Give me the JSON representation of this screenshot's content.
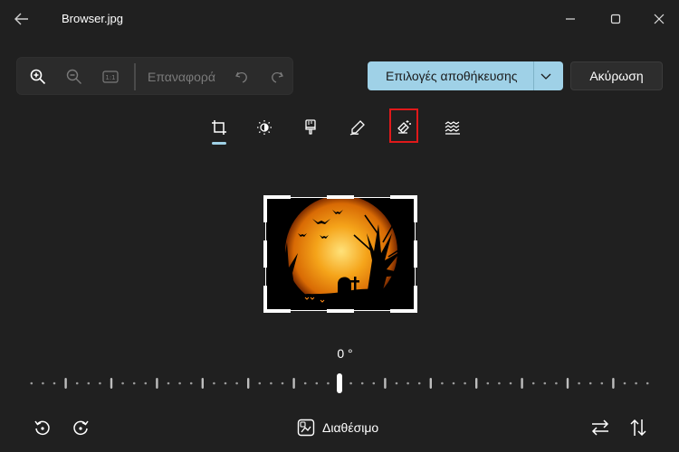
{
  "titlebar": {
    "title": "Browser.jpg",
    "icons": {
      "back": "back-arrow-icon",
      "minimize": "minimize-icon",
      "maximize": "maximize-icon",
      "close": "close-icon"
    }
  },
  "toolbar": {
    "reset_label": "Επαναφορά",
    "actual_size_label": "1:1",
    "icons": [
      "zoom-in-icon",
      "zoom-out-icon",
      "actual-size-icon",
      "undo-icon",
      "redo-icon"
    ]
  },
  "actions": {
    "save_options_label": "Επιλογές αποθήκευσης",
    "cancel_label": "Ακύρωση",
    "accent_color": "#9fd1e7"
  },
  "tools": {
    "items": [
      "crop-tool",
      "adjustment-tool",
      "filter-tool",
      "markup-tool",
      "retouch-tool",
      "background-blur-tool"
    ],
    "selected": "crop-tool",
    "highlighted": "retouch-tool",
    "highlight_color": "#e0191a"
  },
  "rotation": {
    "angle_label": "0 °",
    "angle_value": 0
  },
  "bottom": {
    "aspect_label": "Διαθέσιμο",
    "icons": [
      "rotate-left-icon",
      "rotate-right-icon",
      "aspect-ratio-icon",
      "flip-horizontal-icon",
      "flip-vertical-icon"
    ]
  }
}
